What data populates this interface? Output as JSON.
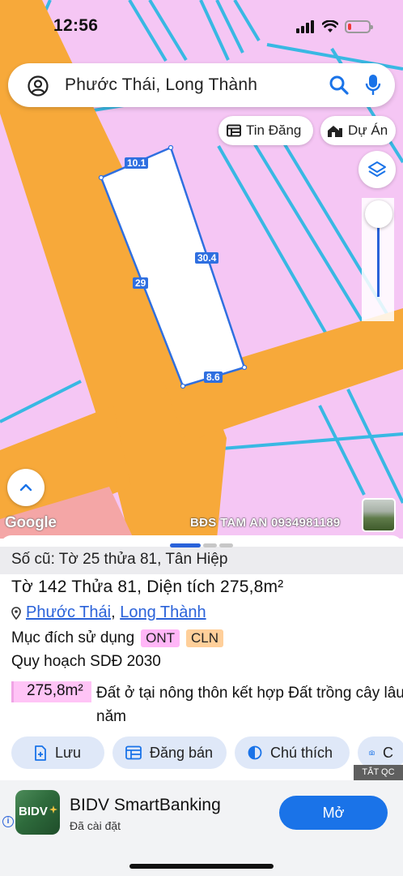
{
  "status_bar": {
    "time": "12:56",
    "battery_level": 0.15
  },
  "search": {
    "text": "Phước Thái, Long Thành"
  },
  "chips": {
    "tin_dang": "Tin Đăng",
    "du_an": "Dự Án"
  },
  "map": {
    "dimensions": {
      "top": "10.1",
      "right": "30.4",
      "left": "29",
      "bottom": "8.6"
    },
    "google_logo": "Google",
    "watermark": "BĐS TAM AN 0934981189",
    "colors": {
      "land": "#f5c6f4",
      "road": "#f7a93a",
      "parcel_line": "#39b8e3",
      "selection": "#2f6fe0",
      "agri": "#f4a6a6"
    }
  },
  "sheet": {
    "old_ref": "Số cũ: Tờ 25 thửa 81, Tân Hiệp",
    "parcel_title": "Tờ 142 Thửa 81, Diện tích 275,8m²",
    "location": {
      "commune": "Phước Thái",
      "separator": ", ",
      "district": "Long Thành"
    },
    "purpose_label": "Mục đích sử dụng",
    "purpose_codes": [
      "ONT",
      "CLN"
    ],
    "plan_title": "Quy hoạch SDĐ 2030",
    "area_value": "275,8m²",
    "area_description": "Đất ở tại nông thôn kết hợp Đất trồng cây lâu năm",
    "actions": {
      "save": "Lưu",
      "sell": "Đăng bán",
      "legend": "Chú thích",
      "camera": "C"
    }
  },
  "ad": {
    "tag": "TẮT QC",
    "info": "i",
    "logo_text": "BIDV",
    "title": "BIDV SmartBanking",
    "subtitle": "Đã cài đặt",
    "cta": "Mở"
  }
}
